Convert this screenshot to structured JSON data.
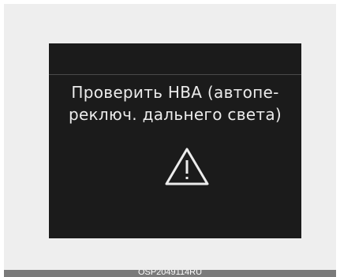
{
  "display": {
    "message_line1": "Проверить HBA (автопе-",
    "message_line2": "реключ. дальнего света)",
    "icon": "warning-triangle-icon"
  },
  "caption": "OSP2049114RU",
  "colors": {
    "screen_background": "#1b1b1b",
    "text": "#ececec",
    "frame": "#eeeeee",
    "caption_bar": "#7a7a7a"
  }
}
